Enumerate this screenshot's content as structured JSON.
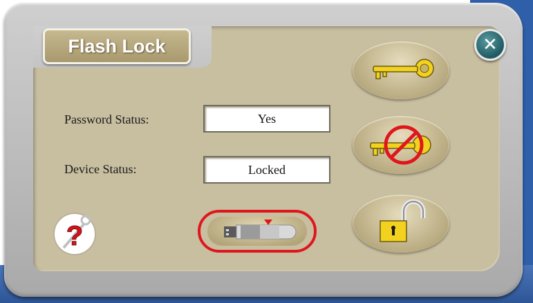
{
  "app": {
    "title": "Flash Lock",
    "close_icon": "close-icon"
  },
  "status": {
    "password_label": "Password Status:",
    "password_value": "Yes",
    "device_label": "Device Status:",
    "device_value": "Locked"
  },
  "buttons": {
    "set_password": {
      "icon": "key-icon"
    },
    "remove_password": {
      "icon": "key-forbidden-icon"
    },
    "unlock": {
      "icon": "unlock-padlock-icon"
    },
    "help": {
      "icon": "help-key-icon"
    },
    "lock_device": {
      "icon": "usb-drive-icon",
      "highlighted": true
    }
  },
  "colors": {
    "panel": "#c8bea0",
    "tab": "#a8996d",
    "highlight": "#e0161d",
    "key": "#f2d21e"
  }
}
